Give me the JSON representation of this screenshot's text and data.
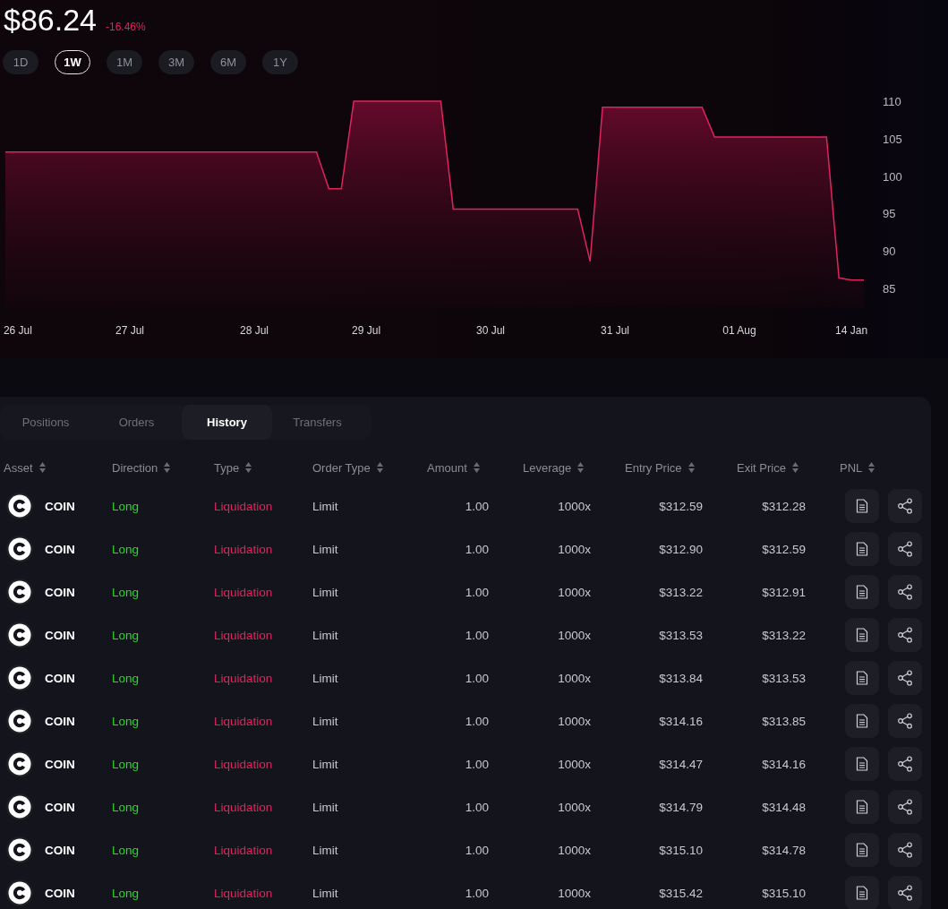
{
  "price": {
    "value": "$86.24",
    "change": "-16.46%"
  },
  "ranges": [
    {
      "label": "1D",
      "selected": false
    },
    {
      "label": "1W",
      "selected": true
    },
    {
      "label": "1M",
      "selected": false
    },
    {
      "label": "3M",
      "selected": false
    },
    {
      "label": "6M",
      "selected": false
    },
    {
      "label": "1Y",
      "selected": false
    }
  ],
  "chart": {
    "chart_data": {
      "type": "area",
      "categories": [
        null,
        "26 Jul",
        null,
        null,
        null,
        null,
        null,
        null,
        null,
        null,
        "27 Jul",
        null,
        null,
        null,
        null,
        null,
        null,
        null,
        null,
        null,
        "28 Jul",
        null,
        null,
        null,
        null,
        null,
        null,
        null,
        null,
        "29 Jul",
        null,
        null,
        null,
        null,
        null,
        null,
        null,
        null,
        null,
        "30 Jul",
        null,
        null,
        null,
        null,
        null,
        null,
        null,
        null,
        null,
        "31 Jul",
        null,
        null,
        null,
        null,
        null,
        null,
        null,
        null,
        null,
        "01 Aug",
        null,
        null,
        null,
        null,
        null,
        null,
        null,
        null,
        "14 Jan",
        null
      ],
      "series": [
        {
          "color": "#e0245e",
          "values": [
            103.2,
            103.2,
            103.2,
            103.2,
            103.2,
            103.2,
            103.2,
            103.2,
            103.2,
            103.2,
            103.2,
            103.2,
            103.2,
            103.2,
            103.2,
            103.2,
            103.2,
            103.2,
            103.2,
            103.2,
            103.2,
            103.2,
            103.2,
            103.2,
            103.2,
            103.2,
            98.3,
            98.3,
            110,
            110,
            110,
            110,
            110,
            110,
            110,
            110,
            95.6,
            95.6,
            95.6,
            95.6,
            95.6,
            95.6,
            95.6,
            95.6,
            95.6,
            95.6,
            95.6,
            88.6,
            109.2,
            109.2,
            109.2,
            109.2,
            109.2,
            109.2,
            109.2,
            109.2,
            109.2,
            105.2,
            105.2,
            105.2,
            105.2,
            105.2,
            105.2,
            105.2,
            105.2,
            105.2,
            105.2,
            86.4,
            86.1,
            86.1
          ]
        }
      ],
      "ylim": [
        85,
        110
      ],
      "yticks": [
        85,
        90,
        95,
        100,
        105,
        110
      ]
    }
  },
  "tabs": [
    {
      "label": "Positions",
      "selected": false
    },
    {
      "label": "Orders",
      "selected": false
    },
    {
      "label": "History",
      "selected": true
    },
    {
      "label": "Transfers",
      "selected": false
    }
  ],
  "table": {
    "columns": [
      "Asset",
      "Direction",
      "Type",
      "Order Type",
      "Amount",
      "Leverage",
      "Entry Price",
      "Exit Price",
      "PNL"
    ],
    "rows": [
      {
        "asset": "COIN",
        "direction": "Long",
        "type": "Liquidation",
        "order_type": "Limit",
        "amount": "1.00",
        "leverage": "1000x",
        "entry_price": "$312.59",
        "exit_price": "$312.28"
      },
      {
        "asset": "COIN",
        "direction": "Long",
        "type": "Liquidation",
        "order_type": "Limit",
        "amount": "1.00",
        "leverage": "1000x",
        "entry_price": "$312.90",
        "exit_price": "$312.59"
      },
      {
        "asset": "COIN",
        "direction": "Long",
        "type": "Liquidation",
        "order_type": "Limit",
        "amount": "1.00",
        "leverage": "1000x",
        "entry_price": "$313.22",
        "exit_price": "$312.91"
      },
      {
        "asset": "COIN",
        "direction": "Long",
        "type": "Liquidation",
        "order_type": "Limit",
        "amount": "1.00",
        "leverage": "1000x",
        "entry_price": "$313.53",
        "exit_price": "$313.22"
      },
      {
        "asset": "COIN",
        "direction": "Long",
        "type": "Liquidation",
        "order_type": "Limit",
        "amount": "1.00",
        "leverage": "1000x",
        "entry_price": "$313.84",
        "exit_price": "$313.53"
      },
      {
        "asset": "COIN",
        "direction": "Long",
        "type": "Liquidation",
        "order_type": "Limit",
        "amount": "1.00",
        "leverage": "1000x",
        "entry_price": "$314.16",
        "exit_price": "$313.85"
      },
      {
        "asset": "COIN",
        "direction": "Long",
        "type": "Liquidation",
        "order_type": "Limit",
        "amount": "1.00",
        "leverage": "1000x",
        "entry_price": "$314.47",
        "exit_price": "$314.16"
      },
      {
        "asset": "COIN",
        "direction": "Long",
        "type": "Liquidation",
        "order_type": "Limit",
        "amount": "1.00",
        "leverage": "1000x",
        "entry_price": "$314.79",
        "exit_price": "$314.48"
      },
      {
        "asset": "COIN",
        "direction": "Long",
        "type": "Liquidation",
        "order_type": "Limit",
        "amount": "1.00",
        "leverage": "1000x",
        "entry_price": "$315.10",
        "exit_price": "$314.78"
      },
      {
        "asset": "COIN",
        "direction": "Long",
        "type": "Liquidation",
        "order_type": "Limit",
        "amount": "1.00",
        "leverage": "1000x",
        "entry_price": "$315.42",
        "exit_price": "$315.10"
      }
    ]
  }
}
